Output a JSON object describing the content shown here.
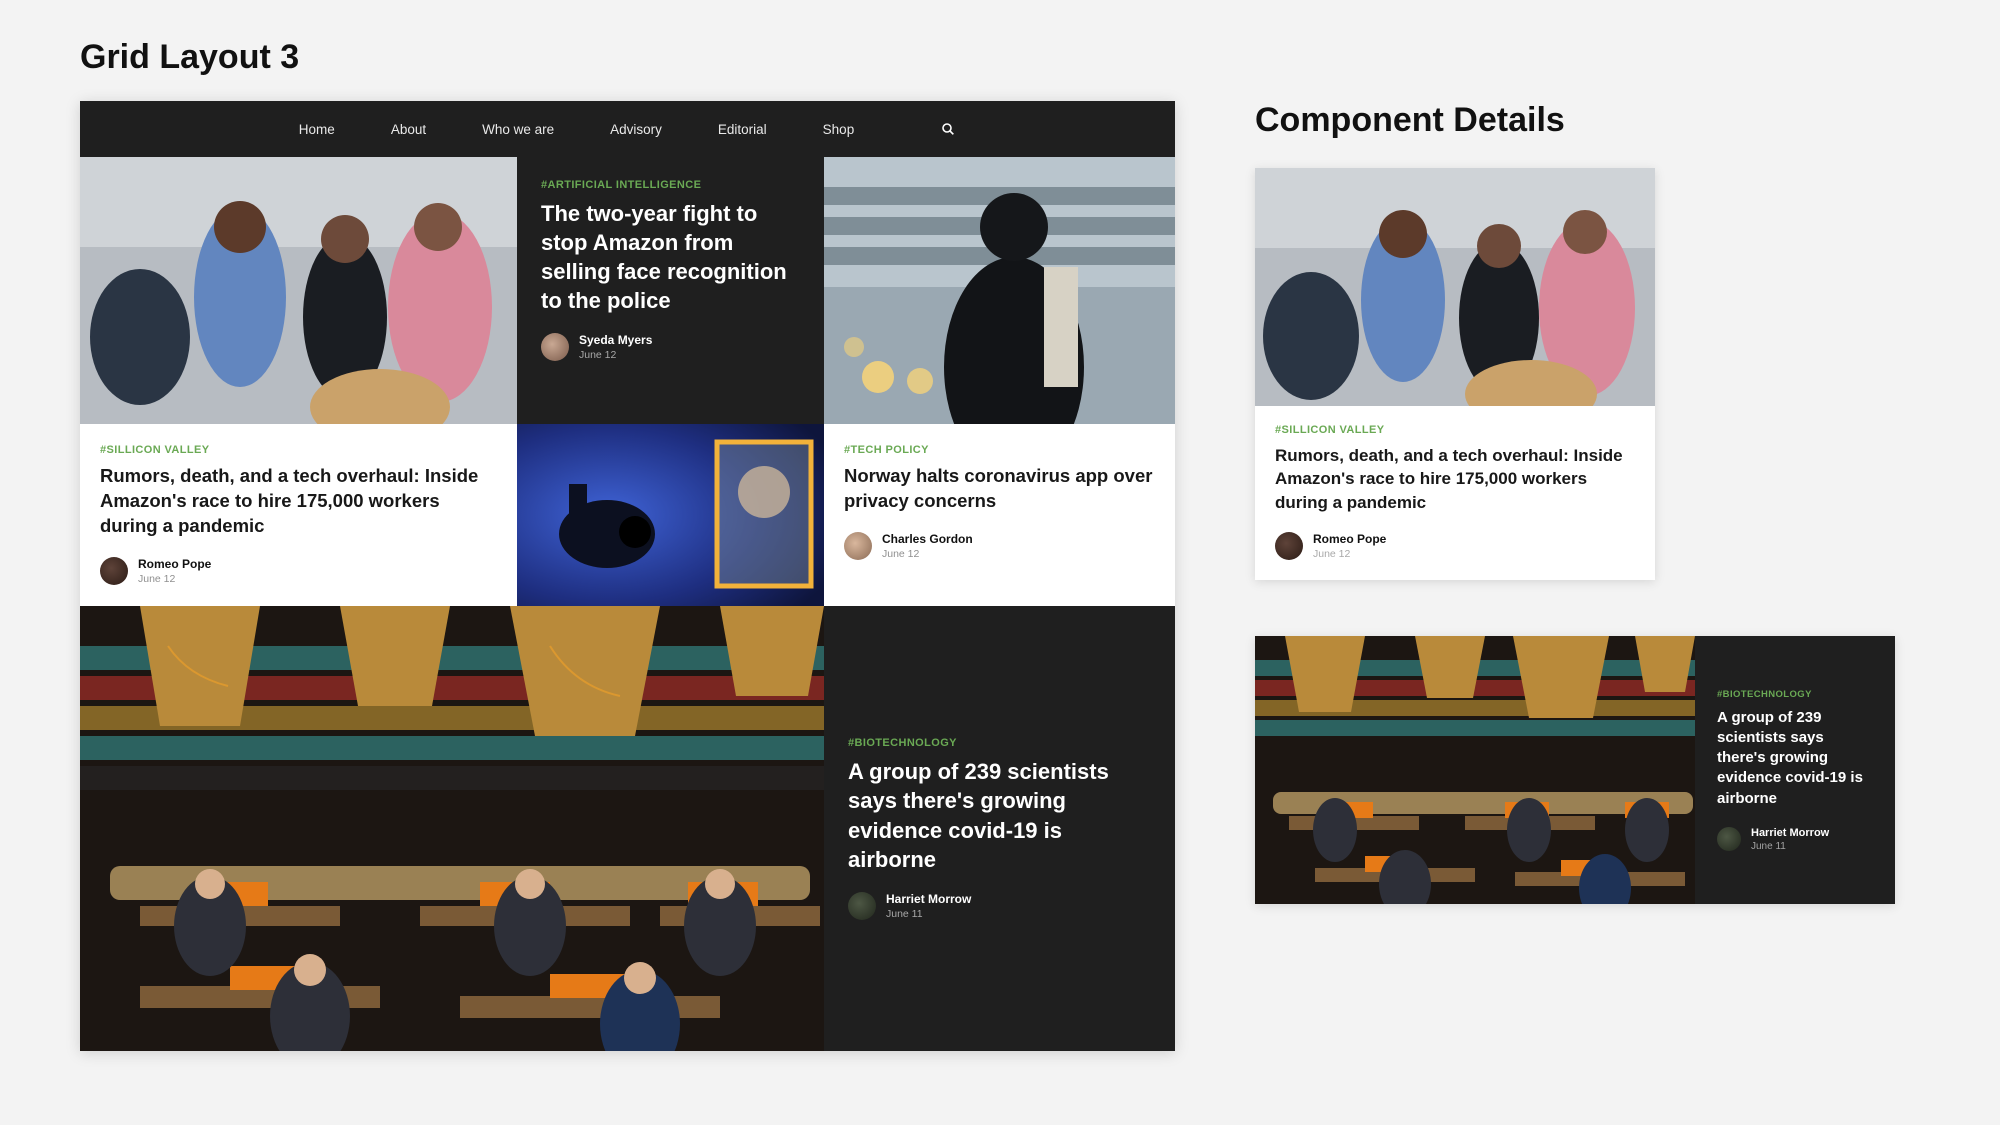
{
  "page_title": "Grid Layout 3",
  "details_title": "Component Details",
  "nav": {
    "items": [
      "Home",
      "About",
      "Who we are",
      "Advisory",
      "Editorial",
      "Shop"
    ]
  },
  "cards": {
    "ai": {
      "tag": "#ARTIFICIAL INTELLIGENCE",
      "title": "The two-year fight to stop Amazon from selling face recognition to the police",
      "author": "Syeda Myers",
      "date": "June 12"
    },
    "silicon": {
      "tag": "#SILLICON VALLEY",
      "title": "Rumors, death, and a tech overhaul: Inside Amazon's race to hire 175,000 workers during a pandemic",
      "author": "Romeo Pope",
      "date": "June 12"
    },
    "tech": {
      "tag": "#TECH POLICY",
      "title": "Norway halts corona­virus app over privacy concerns",
      "author": "Charles Gordon",
      "date": "June 12"
    },
    "bio": {
      "tag": "#BIOTECHNOLOGY",
      "title": "A group of 239 scientists says there's growing evidence covid-19 is airborne",
      "author": "Harriet Morrow",
      "date": "June 11"
    }
  },
  "details": {
    "light": {
      "tag": "#SILLICON VALLEY",
      "title": "Rumors, death, and a tech overhaul: Inside Amazon's race to hire 175,000 workers during a pandemic",
      "author": "Romeo Pope",
      "date": "June 12"
    },
    "dark": {
      "tag": "#BIOTECHNOLOGY",
      "title": "A group of 239 scientists says there's growing evidence covid-19 is airborne",
      "author": "Harriet Morrow",
      "date": "June 11"
    }
  }
}
